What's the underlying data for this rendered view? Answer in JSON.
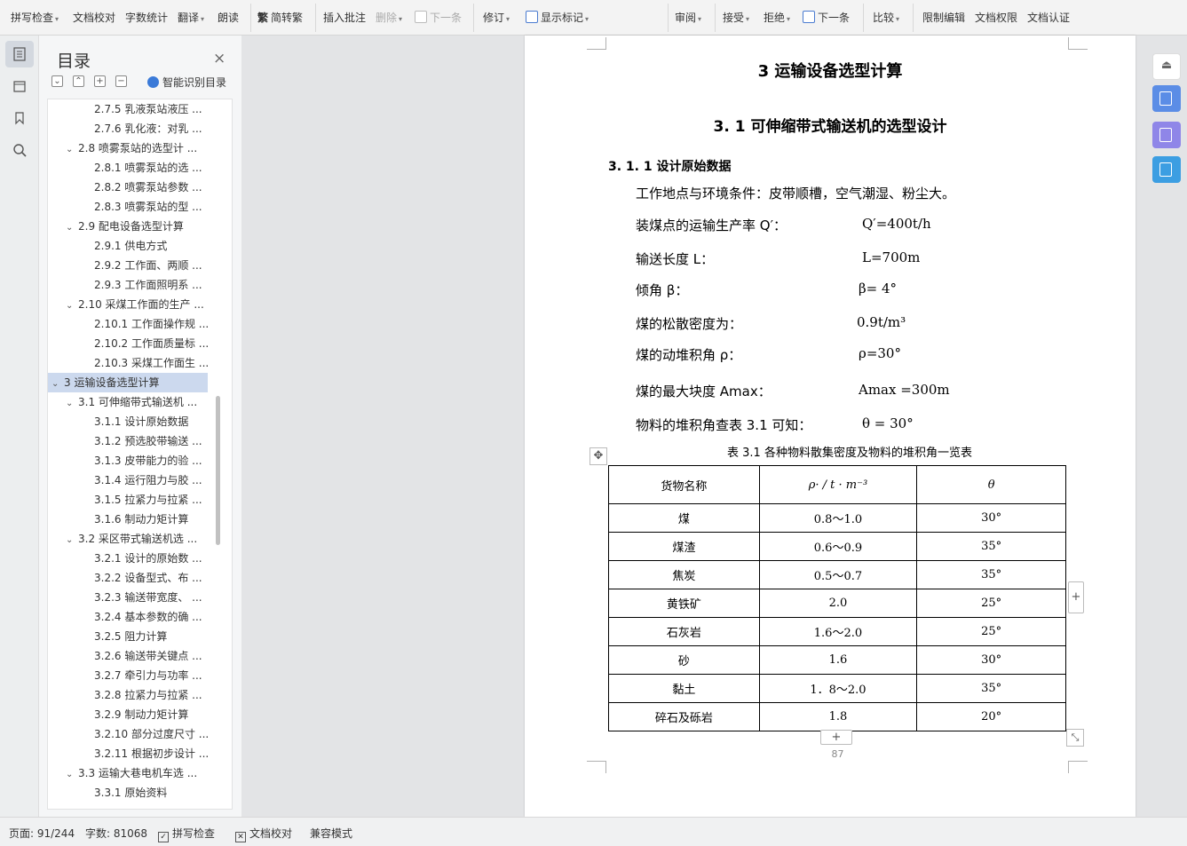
{
  "ribbon": {
    "items": [
      {
        "label": "拼写检查",
        "arrow": true
      },
      {
        "label": "文档校对"
      },
      {
        "label": "字数统计"
      },
      {
        "label": "翻译",
        "arrow": true
      },
      {
        "label": "朗读"
      },
      {
        "label": "简转繁"
      },
      {
        "label": "插入批注"
      },
      {
        "label": "删除",
        "arrow": true
      },
      {
        "label": "下一条"
      },
      {
        "label": "修订",
        "arrow": true
      },
      {
        "label": "显示标记",
        "arrow": true
      },
      {
        "label": "审阅",
        "arrow": true
      },
      {
        "label": "接受",
        "arrow": true
      },
      {
        "label": "拒绝",
        "arrow": true
      },
      {
        "label": "下一条"
      },
      {
        "label": "比较",
        "arrow": true
      },
      {
        "label": "限制编辑"
      },
      {
        "label": "文档权限"
      },
      {
        "label": "文档认证"
      }
    ]
  },
  "toc": {
    "title": "目录",
    "smart_label": "智能识别目录",
    "items": [
      {
        "label": "2.7.5 乳液泵站液压 ...",
        "level": 3
      },
      {
        "label": "2.7.6 乳化液：对乳 ...",
        "level": 3
      },
      {
        "label": "2.8 喷雾泵站的选型计 ...",
        "level": 2,
        "chev": "⌄"
      },
      {
        "label": "2.8.1 喷雾泵站的选 ...",
        "level": 3
      },
      {
        "label": "2.8.2 喷雾泵站参数 ...",
        "level": 3
      },
      {
        "label": "2.8.3 喷雾泵站的型 ...",
        "level": 3
      },
      {
        "label": "2.9  配电设备选型计算",
        "level": 2,
        "chev": "⌄"
      },
      {
        "label": "2.9.1 供电方式",
        "level": 3
      },
      {
        "label": "2.9.2 工作面、两顺 ...",
        "level": 3
      },
      {
        "label": "2.9.3 工作面照明系 ...",
        "level": 3
      },
      {
        "label": "2.10 采煤工作面的生产 ...",
        "level": 2,
        "chev": "⌄"
      },
      {
        "label": "2.10.1 工作面操作规 ...",
        "level": 3
      },
      {
        "label": "2.10.2 工作面质量标 ...",
        "level": 3
      },
      {
        "label": "2.10.3 采煤工作面生 ...",
        "level": 3
      },
      {
        "label": "3 运输设备选型计算",
        "level": 1,
        "chev": "⌄",
        "selected": true
      },
      {
        "label": "3.1 可伸缩带式输送机 ...",
        "level": 2,
        "chev": "⌄"
      },
      {
        "label": "3.1.1 设计原始数据",
        "level": 3
      },
      {
        "label": "3.1.2 预选胶带输送 ...",
        "level": 3
      },
      {
        "label": "3.1.3 皮带能力的验 ...",
        "level": 3
      },
      {
        "label": "3.1.4 运行阻力与胶 ...",
        "level": 3
      },
      {
        "label": "3.1.5 拉紧力与拉紧 ...",
        "level": 3
      },
      {
        "label": "3.1.6 制动力矩计算",
        "level": 3
      },
      {
        "label": "3.2 采区带式输送机选 ...",
        "level": 2,
        "chev": "⌄"
      },
      {
        "label": "3.2.1 设计的原始数 ...",
        "level": 3
      },
      {
        "label": "3.2.2 设备型式、布 ...",
        "level": 3
      },
      {
        "label": "3.2.3 输送带宽度、 ...",
        "level": 3
      },
      {
        "label": "3.2.4 基本参数的确 ...",
        "level": 3
      },
      {
        "label": "3.2.5 阻力计算",
        "level": 3
      },
      {
        "label": "3.2.6 输送带关键点 ...",
        "level": 3
      },
      {
        "label": "3.2.7 牵引力与功率 ...",
        "level": 3
      },
      {
        "label": "3.2.8 拉紧力与拉紧 ...",
        "level": 3
      },
      {
        "label": "3.2.9 制动力矩计算",
        "level": 3
      },
      {
        "label": "3.2.10 部分过度尺寸 ...",
        "level": 3
      },
      {
        "label": "3.2.11 根据初步设计 ...",
        "level": 3
      },
      {
        "label": "3.3 运输大巷电机车选 ...",
        "level": 2,
        "chev": "⌄"
      },
      {
        "label": "3.3.1 原始资料",
        "level": 3
      }
    ]
  },
  "document": {
    "heading1": "3 运输设备选型计算",
    "heading2": "3. 1 可伸缩带式输送机的选型设计",
    "heading3": "3. 1. 1 设计原始数据",
    "intro": "工作地点与环境条件：皮带顺槽，空气潮湿、粉尘大。",
    "params": [
      {
        "label": "装煤点的运输生产率 Q′：",
        "value": "Q′=400t/h"
      },
      {
        "label": "输送长度 L：",
        "value": "L=700m"
      },
      {
        "label": "倾角 β：",
        "value": "β= 4°"
      },
      {
        "label": "煤的松散密度为：",
        "value": "0.9t/m³"
      },
      {
        "label": "煤的动堆积角 ρ：",
        "value": "ρ=30°"
      },
      {
        "label": "煤的最大块度 Amax：",
        "value": "Amax =300m"
      },
      {
        "label": "物料的堆积角查表 3.1 可知：",
        "value": "θ = 30°"
      }
    ],
    "table_caption": "表 3.1 各种物料散集密度及物料的堆积角一览表",
    "table_headers": [
      "货物名称",
      "ρ· / t · m⁻³",
      "θ"
    ],
    "table_rows": [
      [
        "煤",
        "0.8～1.0",
        "30°"
      ],
      [
        "煤渣",
        "0.6～0.9",
        "35°"
      ],
      [
        "焦炭",
        "0.5～0.7",
        "35°"
      ],
      [
        "黄铁矿",
        "2.0",
        "25°"
      ],
      [
        "石灰岩",
        "1.6～2.0",
        "25°"
      ],
      [
        "砂",
        "1.6",
        "30°"
      ],
      [
        "黏土",
        "1．8～2.0",
        "35°"
      ],
      [
        "碎石及砾岩",
        "1.8",
        "20°"
      ]
    ],
    "page_number": "87"
  },
  "status": {
    "page": "页面: 91/244",
    "words": "字数: 81068",
    "spell_check": "拼写检查",
    "doc_proof": "文档校对",
    "compat_mode": "兼容模式"
  }
}
